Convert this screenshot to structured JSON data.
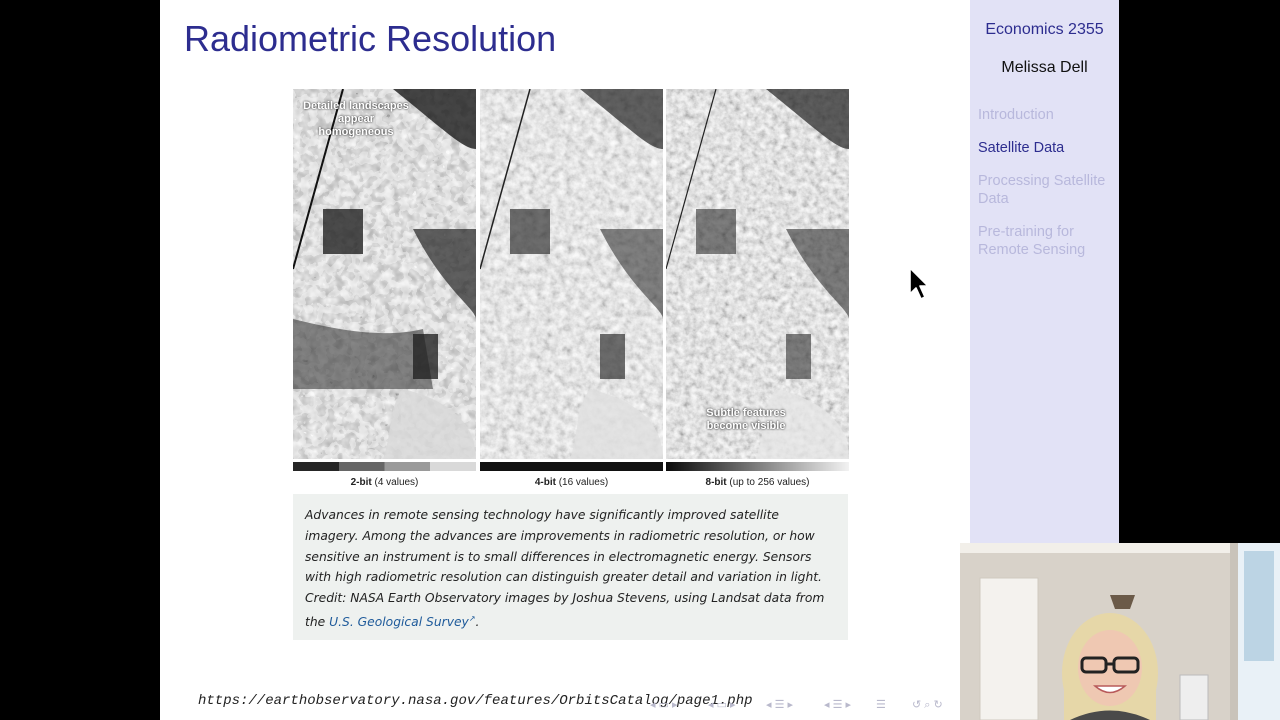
{
  "slide": {
    "title": "Radiometric Resolution",
    "figure": {
      "label_top_left": "Detailed landscapes appear homogeneous",
      "label_bottom_right": "Subtle features become visible",
      "panels": [
        {
          "bits": "2-bit",
          "detail": "(4 values)"
        },
        {
          "bits": "4-bit",
          "detail": "(16 values)"
        },
        {
          "bits": "8-bit",
          "detail": "(up to 256 values)"
        }
      ]
    },
    "caption": {
      "text": "Advances in remote sensing technology have significantly improved satellite imagery. Among the advances are improvements in radiometric resolution, or how sensitive an instrument is to small differences in electromagnetic energy. Sensors with high radiometric resolution can distinguish greater detail and variation in light.",
      "credit_prefix": "Credit: NASA Earth Observatory images by Joshua Stevens, using Landsat data from the",
      "credit_link": "U.S. Geological Survey",
      "credit_suffix": "."
    },
    "source_url": "https://earthobservatory.nasa.gov/features/OrbitsCatalog/page1.php"
  },
  "sidebar": {
    "course": "Economics 2355",
    "author": "Melissa Dell",
    "sections": [
      {
        "label": "Introduction",
        "active": false
      },
      {
        "label": "Satellite Data",
        "active": true
      },
      {
        "label": "Processing Satellite Data",
        "active": false
      },
      {
        "label": "Pre-training for Remote Sensing",
        "active": false
      }
    ]
  },
  "icons": {
    "cursor": "mouse-pointer-icon",
    "nav": "beamer-navigation-icons"
  },
  "colors": {
    "title": "#2d2d8f",
    "sidebar_bg": "#e2e2f6",
    "sidebar_inactive": "#b8b8dc",
    "caption_bg": "#eef1ef",
    "link": "#1e5a9a"
  }
}
